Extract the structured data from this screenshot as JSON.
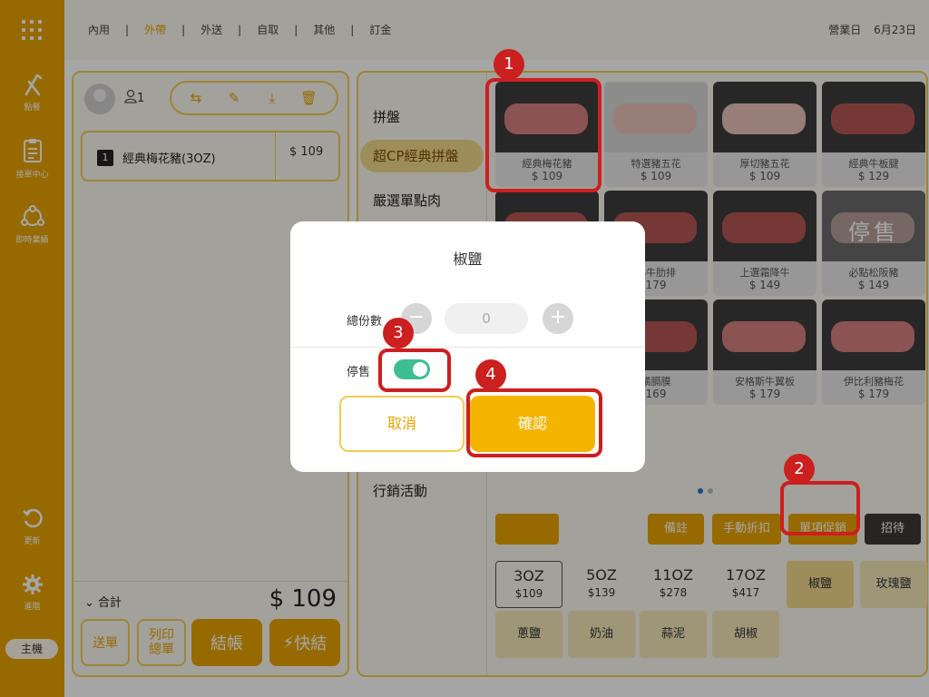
{
  "topbar": {
    "tabs": [
      {
        "label": "內用",
        "active": false
      },
      {
        "label": "外帶",
        "active": true
      },
      {
        "label": "外送",
        "active": false
      },
      {
        "label": "自取",
        "active": false
      },
      {
        "label": "其他",
        "active": false
      },
      {
        "label": "訂金",
        "active": false
      }
    ],
    "separator": "|",
    "business_day_label": "營業日",
    "business_day_value": "6月23日"
  },
  "sidebar": {
    "items": [
      {
        "label": "點餐",
        "icon": "order-icon"
      },
      {
        "label": "接單中心",
        "icon": "clipboard-icon"
      },
      {
        "label": "即時業績",
        "icon": "network-icon"
      },
      {
        "label": "更新",
        "icon": "refresh-icon"
      },
      {
        "label": "進階",
        "icon": "gear-icon"
      }
    ],
    "host_label": "主機"
  },
  "order": {
    "guest_count": "1",
    "line": {
      "qty": "1",
      "name": "經典梅花豬(3OZ)",
      "price": "$ 109"
    },
    "total_label": "合計",
    "total_value": "$ 109",
    "buttons": {
      "send": "送單",
      "print": "列印 總單",
      "checkout": "結帳",
      "quick": "快結"
    }
  },
  "menu": {
    "categories": [
      "拼盤",
      "超CP經典拼盤",
      "嚴選單點肉",
      "行銷活動"
    ],
    "active_category": "超CP經典拼盤",
    "cards": [
      {
        "name": "經典梅花豬",
        "price": "$ 109"
      },
      {
        "name": "特選豬五花",
        "price": "$ 109"
      },
      {
        "name": "厚切豬五花",
        "price": "$ 109"
      },
      {
        "name": "經典牛板腱",
        "price": "$ 129"
      },
      {
        "name": "",
        "price": ""
      },
      {
        "name": "小牛肋排",
        "price": "179"
      },
      {
        "name": "上選霜降牛",
        "price": "$ 149"
      },
      {
        "name": "必點松阪豬",
        "price": "$ 149",
        "stopped_label": "停售"
      },
      {
        "name": "",
        "price": ""
      },
      {
        "name": "橫膈膜",
        "price": "169"
      },
      {
        "name": "安格斯牛翼板",
        "price": "$ 179"
      },
      {
        "name": "伊比利豬梅花",
        "price": "$ 179"
      }
    ],
    "func_buttons": [
      "備註",
      "手動折扣",
      "單項促銷",
      "招待"
    ],
    "sizes": [
      {
        "label": "3OZ",
        "price": "$109"
      },
      {
        "label": "5OZ",
        "price": "$139"
      },
      {
        "label": "11OZ",
        "price": "$278"
      },
      {
        "label": "17OZ",
        "price": "$417"
      }
    ],
    "seasonings": [
      "椒鹽",
      "玫瑰鹽",
      "蔥鹽",
      "奶油",
      "蒜泥",
      "胡椒"
    ]
  },
  "dialog": {
    "title": "椒鹽",
    "total_label": "總份數",
    "total_value": "0",
    "minus": "−",
    "plus": "+",
    "stop_label": "停售",
    "stop_on": true,
    "cancel": "取消",
    "confirm": "確認"
  },
  "annotations": [
    "1",
    "2",
    "3",
    "4"
  ],
  "colors": {
    "accent": "#e9a300",
    "highlight": "#cc1f1f",
    "toggle": "#3ebd93"
  }
}
